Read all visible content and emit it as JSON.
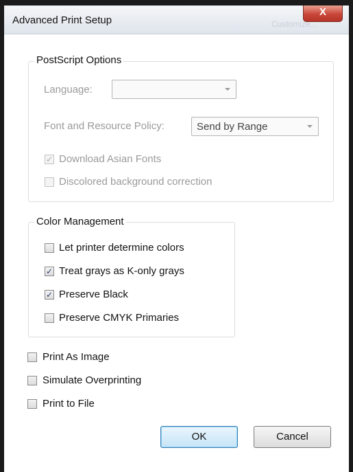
{
  "window": {
    "title": "Advanced Print Setup",
    "title_ghost": "Customize...",
    "close_glyph": "X"
  },
  "postscript": {
    "legend": "PostScript Options",
    "language_label": "Language:",
    "language_value": "",
    "font_policy_label": "Font and Resource Policy:",
    "font_policy_value": "Send by Range",
    "download_asian_fonts": {
      "label": "Download Asian Fonts",
      "checked": true,
      "enabled": false
    },
    "discolored_bg": {
      "label": "Discolored background correction",
      "checked": false,
      "enabled": false
    }
  },
  "color_management": {
    "legend": "Color Management",
    "items": [
      {
        "label": "Let printer determine colors",
        "checked": false
      },
      {
        "label": "Treat grays as K-only grays",
        "checked": true
      },
      {
        "label": "Preserve Black",
        "checked": true
      },
      {
        "label": "Preserve CMYK Primaries",
        "checked": false
      }
    ]
  },
  "options": [
    {
      "label": "Print As Image",
      "checked": false
    },
    {
      "label": "Simulate Overprinting",
      "checked": false
    },
    {
      "label": "Print to File",
      "checked": false
    }
  ],
  "buttons": {
    "ok": "OK",
    "cancel": "Cancel"
  },
  "check_glyph": "✓"
}
